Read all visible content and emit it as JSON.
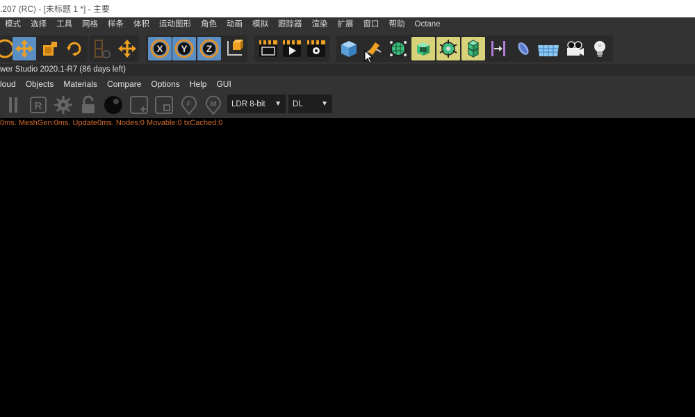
{
  "window": {
    "title": ".207 (RC) - [未标题 1 *] - 主要"
  },
  "c4d_menu": {
    "items": [
      "模式",
      "选择",
      "工具",
      "网格",
      "样条",
      "体积",
      "运动图形",
      "角色",
      "动画",
      "模拟",
      "跟踪器",
      "渲染",
      "扩展",
      "窗口",
      "帮助",
      "Octane"
    ]
  },
  "toolbar": {
    "icons": [
      "select-tool-icon",
      "move-tool-icon",
      "scale-tool-icon",
      "rotate-tool-icon",
      "recent-tools-icon",
      "world-coordinates-icon",
      "x-axis-lock-icon",
      "y-axis-lock-icon",
      "z-axis-lock-icon",
      "coordinate-system-icon",
      "render-region-icon",
      "render-view-icon",
      "render-settings-icon",
      "cube-icon",
      "pen-spline-icon",
      "subdivision-icon",
      "extrude-icon",
      "cloner-icon",
      "mograph-fracture-icon",
      "deformer-icon",
      "deformer-bend-icon",
      "floor-icon",
      "camera-icon",
      "light-icon"
    ],
    "colors": {
      "orange": "#f0a020",
      "blue_select": "#5b8fc4",
      "green": "#3fbf7f",
      "yellow_hl": "#d8d27a"
    }
  },
  "octane": {
    "title": "wer Studio 2020.1-R7 (86 days left)",
    "menu": [
      "loud",
      "Objects",
      "Materials",
      "Compare",
      "Options",
      "Help",
      "GUI"
    ],
    "format_select": "LDR 8-bit",
    "kernel_select": "DL",
    "status": "0ms. MeshGen:0ms. Update0ms. Nodes:0 Movable:0 txCached:0"
  }
}
